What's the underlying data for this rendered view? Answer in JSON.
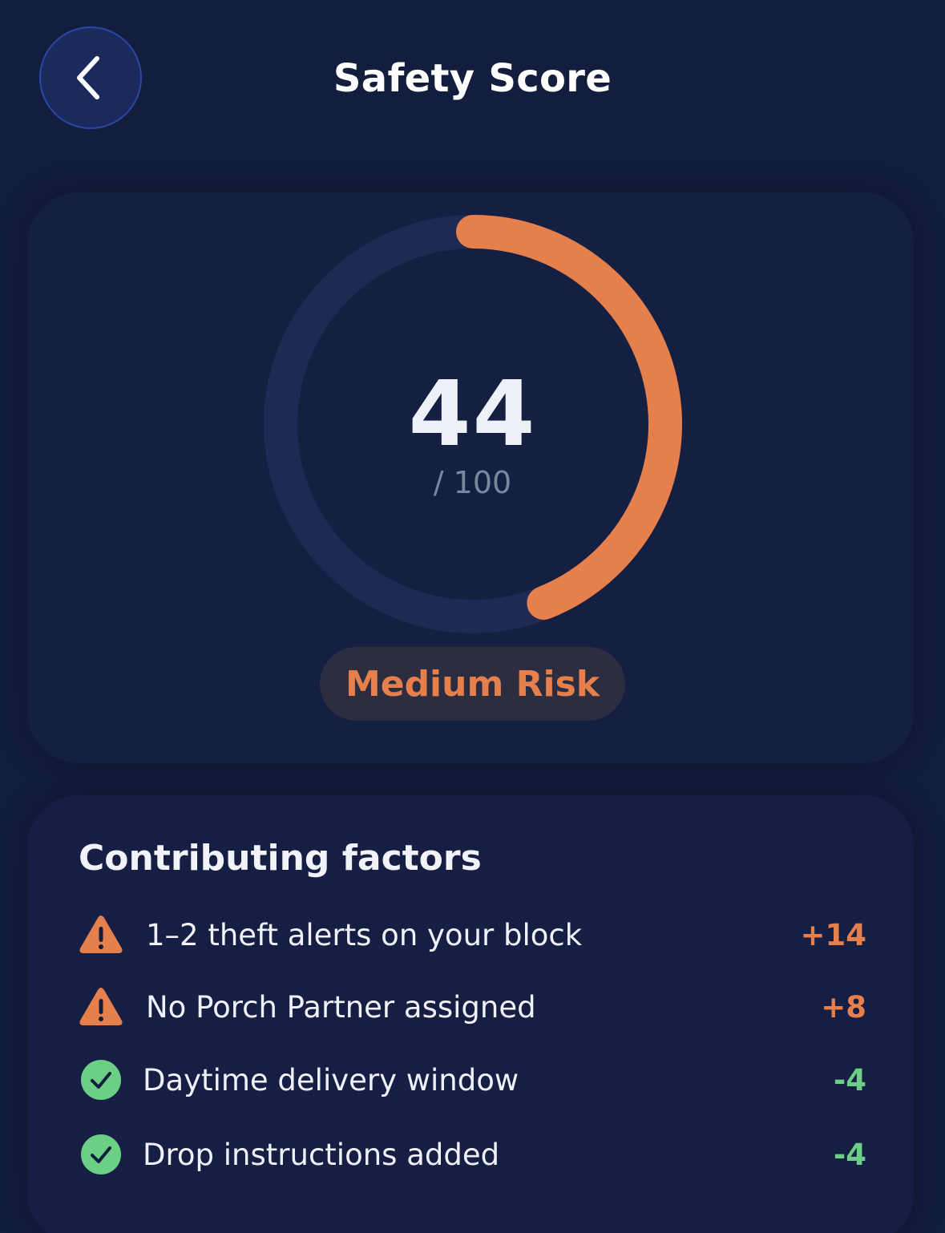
{
  "header": {
    "title": "Safety Score",
    "back_icon": "chevron-left-icon"
  },
  "score": {
    "value": "44",
    "max_label": "/ 100",
    "fraction": 0.44,
    "risk_label": "Medium Risk",
    "colors": {
      "arc": "#e5804d",
      "track": "#1e2a52",
      "badge_text": "#e5804d",
      "badge_bg": "#2d2d41"
    }
  },
  "factors": {
    "heading": "Contributing factors",
    "items": [
      {
        "icon": "warning-icon",
        "label": "1–2 theft alerts on your block",
        "delta": "+14",
        "kind": "negative"
      },
      {
        "icon": "warning-icon",
        "label": "No Porch Partner assigned",
        "delta": "+8",
        "kind": "negative"
      },
      {
        "icon": "check-circle-icon",
        "label": "Daytime delivery window",
        "delta": "-4",
        "kind": "positive"
      },
      {
        "icon": "check-circle-icon",
        "label": "Drop instructions added",
        "delta": "-4",
        "kind": "positive"
      }
    ],
    "colors": {
      "negative": "#e5804d",
      "positive": "#6ccf86"
    }
  },
  "theme": {
    "background": "#131d3d",
    "back_button_bg": "#1a2a5c",
    "back_button_border": "#2b47a6"
  }
}
